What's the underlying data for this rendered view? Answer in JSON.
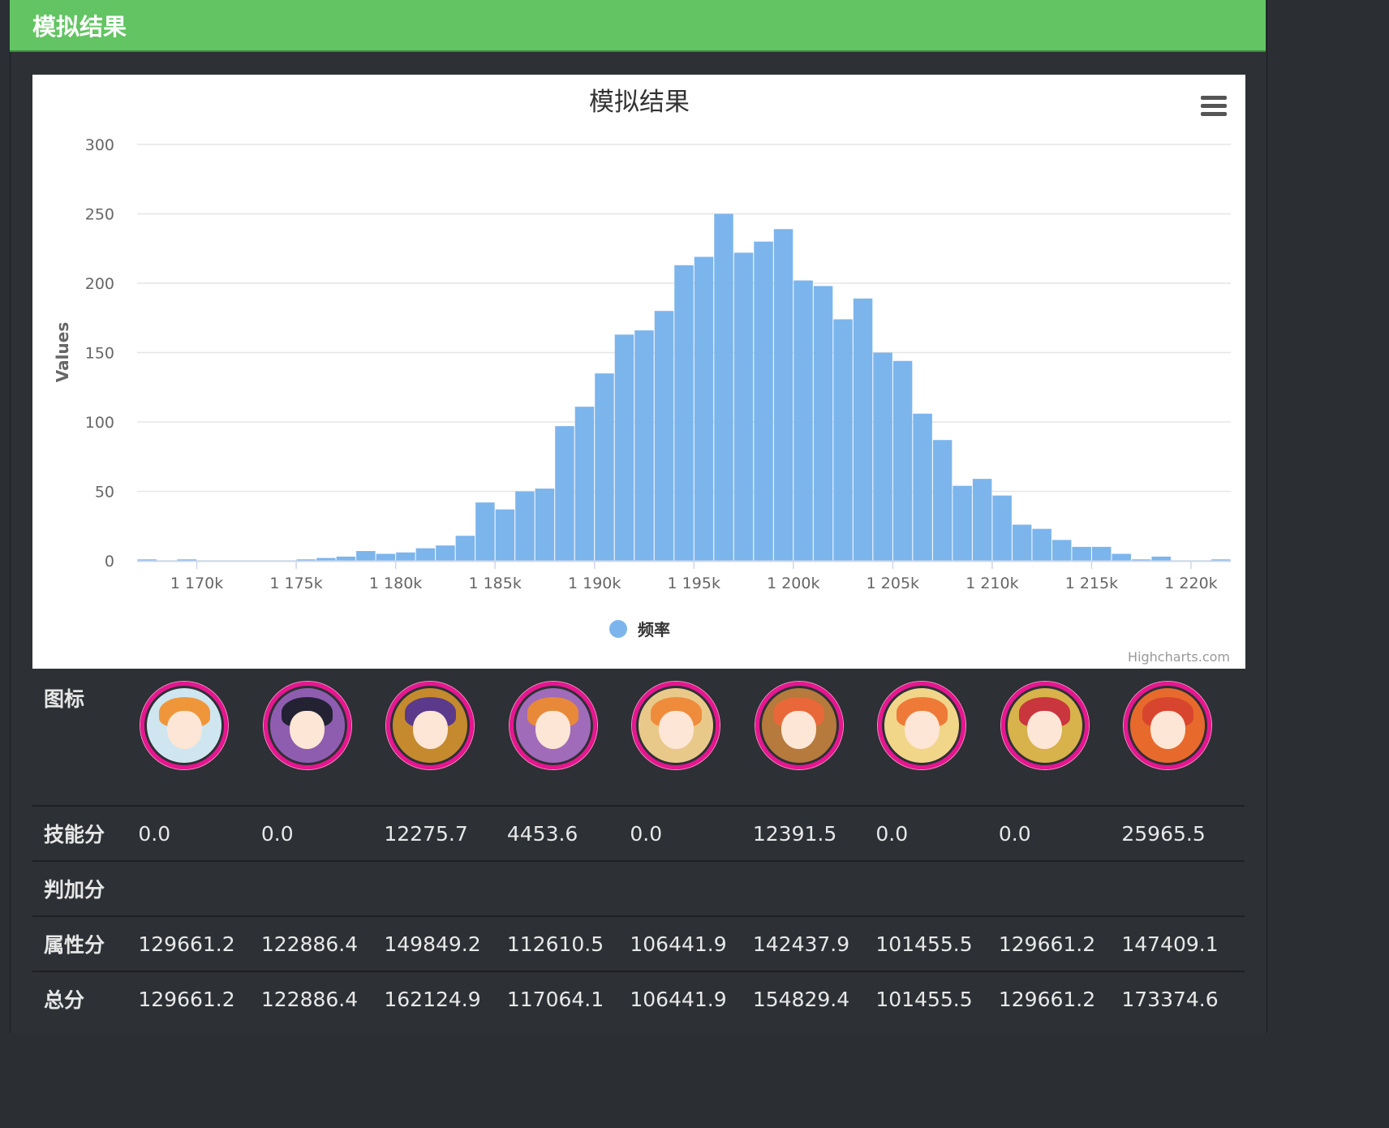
{
  "header": {
    "title": "模拟结果"
  },
  "chart_data": {
    "type": "bar",
    "title": "模拟结果",
    "ylabel": "Values",
    "xlabel": "",
    "xlim": [
      1167000,
      1222000
    ],
    "ylim": [
      0,
      300
    ],
    "yticks": [
      0,
      50,
      100,
      150,
      200,
      250,
      300
    ],
    "xticks": [
      1170000,
      1175000,
      1180000,
      1185000,
      1190000,
      1195000,
      1200000,
      1205000,
      1210000,
      1215000,
      1220000
    ],
    "xtick_labels": [
      "1 170k",
      "1 175k",
      "1 180k",
      "1 185k",
      "1 190k",
      "1 195k",
      "1 200k",
      "1 205k",
      "1 210k",
      "1 215k",
      "1 220k"
    ],
    "bin_width": 1000,
    "series": [
      {
        "name": "频率",
        "color": "#7cb5ec",
        "x": [
          1167500,
          1168500,
          1169500,
          1170500,
          1171500,
          1172500,
          1173500,
          1174500,
          1175500,
          1176500,
          1177500,
          1178500,
          1179500,
          1180500,
          1181500,
          1182500,
          1183500,
          1184500,
          1185500,
          1186500,
          1187500,
          1188500,
          1189500,
          1190500,
          1191500,
          1192500,
          1193500,
          1194500,
          1195500,
          1196500,
          1197500,
          1198500,
          1199500,
          1200500,
          1201500,
          1202500,
          1203500,
          1204500,
          1205500,
          1206500,
          1207500,
          1208500,
          1209500,
          1210500,
          1211500,
          1212500,
          1213500,
          1214500,
          1215500,
          1216500,
          1217500,
          1218500,
          1219500,
          1220500,
          1221500
        ],
        "values": [
          1,
          0,
          1,
          0,
          0,
          0,
          0,
          0,
          1,
          2,
          3,
          7,
          5,
          6,
          9,
          11,
          18,
          42,
          37,
          50,
          52,
          97,
          111,
          135,
          163,
          166,
          180,
          213,
          219,
          250,
          222,
          230,
          239,
          202,
          198,
          174,
          189,
          150,
          144,
          106,
          87,
          54,
          59,
          47,
          26,
          23,
          15,
          10,
          10,
          5,
          1,
          3,
          0,
          0,
          1
        ]
      }
    ],
    "legend_position": "bottom-center",
    "grid": true,
    "credit": "Highcharts.com"
  },
  "table": {
    "rows": [
      {
        "label": "技能分",
        "values": [
          "0.0",
          "0.0",
          "12275.7",
          "4453.6",
          "0.0",
          "12391.5",
          "0.0",
          "0.0",
          "25965.5"
        ]
      },
      {
        "label": "判加分",
        "values": [
          "",
          "",
          "",
          "",
          "",
          "",
          "",
          "",
          ""
        ]
      },
      {
        "label": "属性分",
        "values": [
          "129661.2",
          "122886.4",
          "149849.2",
          "112610.5",
          "106441.9",
          "142437.9",
          "101455.5",
          "129661.2",
          "147409.1"
        ]
      },
      {
        "label": "总分",
        "values": [
          "129661.2",
          "122886.4",
          "162124.9",
          "117064.1",
          "106441.9",
          "154829.4",
          "101455.5",
          "129661.2",
          "173374.6"
        ]
      }
    ],
    "icon_label": "图标",
    "icons": [
      {
        "name": "member-avatar-1",
        "bg": "#cfe6f0",
        "hair": "#f0963a"
      },
      {
        "name": "member-avatar-2",
        "bg": "#8e5db0",
        "hair": "#222233"
      },
      {
        "name": "member-avatar-3",
        "bg": "#c58a2e",
        "hair": "#5b3a8c"
      },
      {
        "name": "member-avatar-4",
        "bg": "#a06bb8",
        "hair": "#e8893a"
      },
      {
        "name": "member-avatar-5",
        "bg": "#e9c98a",
        "hair": "#ef8c3c"
      },
      {
        "name": "member-avatar-6",
        "bg": "#b57a3c",
        "hair": "#e8683a"
      },
      {
        "name": "member-avatar-7",
        "bg": "#f1d68a",
        "hair": "#ef7a38"
      },
      {
        "name": "member-avatar-8",
        "bg": "#d8b24a",
        "hair": "#c9363e"
      },
      {
        "name": "member-avatar-9",
        "bg": "#e76a2c",
        "hair": "#d8452f"
      }
    ]
  }
}
